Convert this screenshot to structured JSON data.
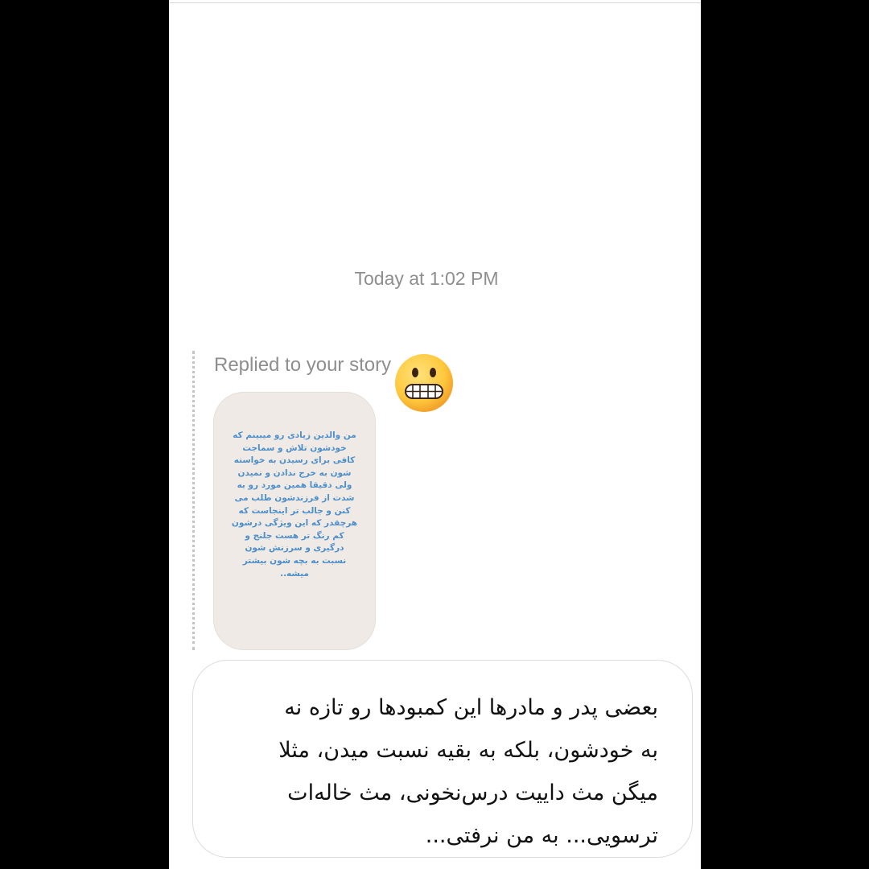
{
  "thread": {
    "timestamp": "Today at 1:02 PM",
    "reply_label": "Replied to your story",
    "story_preview_text": "من والدین زیادی رو میبینم که\nخودشون تلاش و سماجت\nکافی برای رسیدن به خواسته\nشون به خرج ندادن و نمیدن\nولی دقیقا همین مورد رو به\nشدت از فرزندشون طلب می\nکنن و جالب تر اینجاست که\nهرچقدر که این ویژگی درشون\nکم رنگ تر هست جلنج و\nدرگیری و سرزنش شون\nنسبت به بچه شون بیشتر\nمیشه..",
    "reaction_emoji": "grimacing-face",
    "message_text": "بعضی پدر و مادرها این کمبودها رو تازه نه\nبه خودشون، بلکه به بقیه نسبت میدن، مثلا\nمیگن مث داییت درس‌نخونی، مث خاله‌ات\nترسویی... به من نرفتی..."
  },
  "colors": {
    "background_outer": "#000000",
    "background_screen": "#ffffff",
    "meta_text": "#8e8e8e",
    "story_bg": "#efeae6",
    "story_text": "#4e8fc9",
    "bubble_border": "#dcdcdc",
    "message_text": "#111111",
    "emoji_face": "#ffc83d"
  }
}
